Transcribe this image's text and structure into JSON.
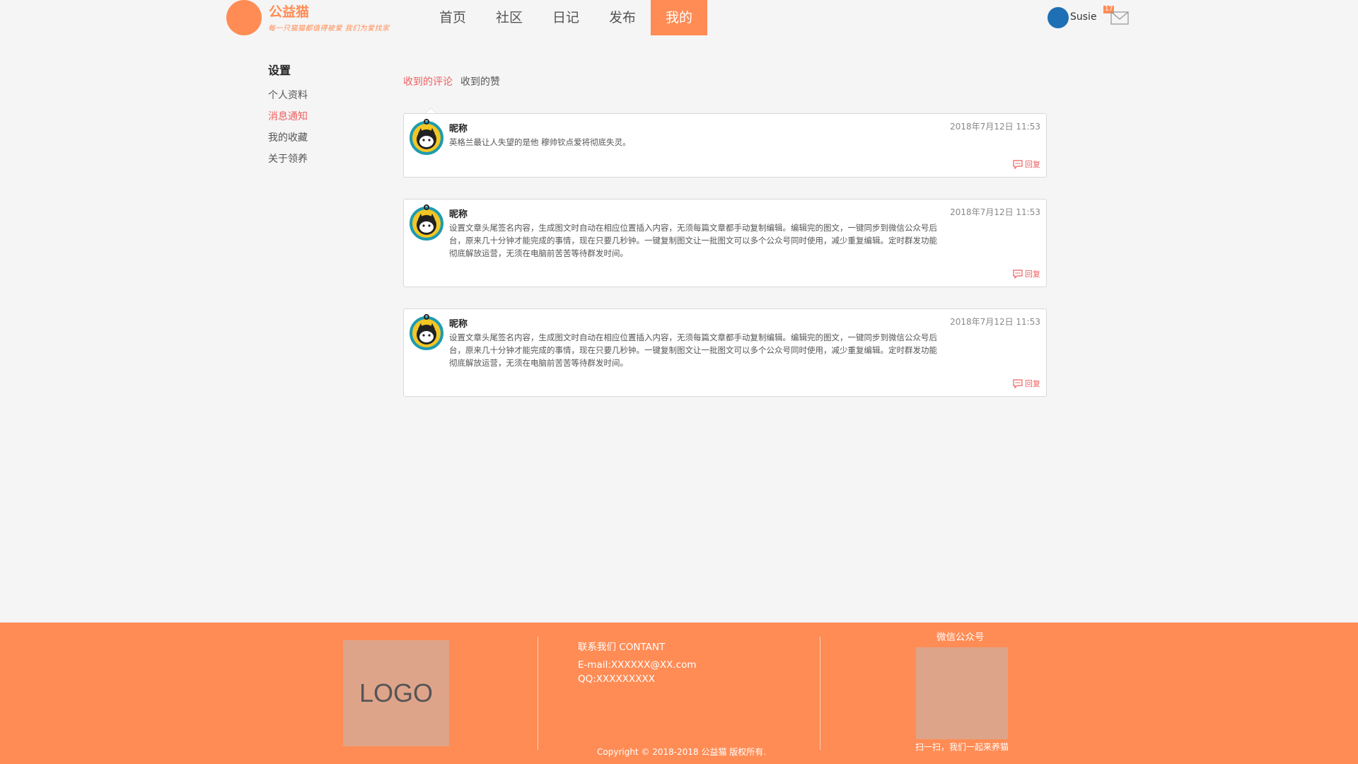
{
  "header": {
    "brand_name": "公益猫",
    "brand_slogan": "每一只猫猫都值得被爱 我们为爱找家",
    "nav": [
      {
        "label": "首页",
        "active": false
      },
      {
        "label": "社区",
        "active": false
      },
      {
        "label": "日记",
        "active": false
      },
      {
        "label": "发布",
        "active": false
      },
      {
        "label": "我的",
        "active": true
      }
    ],
    "user_name": "Susie",
    "mail_badge": "17"
  },
  "sidebar": {
    "title": "设置",
    "items": [
      {
        "label": "个人资料",
        "active": false
      },
      {
        "label": "消息通知",
        "active": true
      },
      {
        "label": "我的收藏",
        "active": false
      },
      {
        "label": "关于领养",
        "active": false
      }
    ]
  },
  "tabs": [
    {
      "label": "收到的评论",
      "active": true
    },
    {
      "label": "收到的赞",
      "active": false
    }
  ],
  "comments": [
    {
      "nickname": "昵称",
      "time": "2018年7月12日 11:53",
      "text": "英格兰最让人失望的是他 穆帅钦点爱将彻底失灵。",
      "reply_label": "回复"
    },
    {
      "nickname": "昵称",
      "time": "2018年7月12日 11:53",
      "text": "设置文章头尾签名内容，生成图文时自动在相应位置插入内容，无须每篇文章都手动复制编辑。编辑完的图文，一键同步到微信公众号后台，原来几十分钟才能完成的事情，现在只要几秒钟。一键复制图文让一批图文可以多个公众号同时使用，减少重复编辑。定时群发功能彻底解放运营，无须在电脑前苦苦等待群发时间。",
      "reply_label": "回复"
    },
    {
      "nickname": "昵称",
      "time": "2018年7月12日 11:53",
      "text": "设置文章头尾签名内容，生成图文时自动在相应位置插入内容，无须每篇文章都手动复制编辑。编辑完的图文，一键同步到微信公众号后台，原来几十分钟才能完成的事情，现在只要几秒钟。一键复制图文让一批图文可以多个公众号同时使用，减少重复编辑。定时群发功能彻底解放运营，无须在电脑前苦苦等待群发时间。",
      "reply_label": "回复"
    }
  ],
  "footer": {
    "logo_text": "LOGO",
    "contact_title": "联系我们 CONTANT",
    "email": "E-mail:XXXXXX@XX.com",
    "qq": "QQ:XXXXXXXXX",
    "copyright": "Copyright © 2018-2018 公益猫 版权所有.",
    "wechat_title": "微信公众号",
    "qr_caption": "扫一扫，我们一起来养猫"
  },
  "colors": {
    "brand": "#ff8c55",
    "accent_red": "#ef5f5f",
    "avatar_blue": "#1f6fb5"
  },
  "icons": {
    "mail": "mail-icon",
    "reply": "chat-bubble-icon",
    "avatar": "cat-avatar-icon"
  }
}
